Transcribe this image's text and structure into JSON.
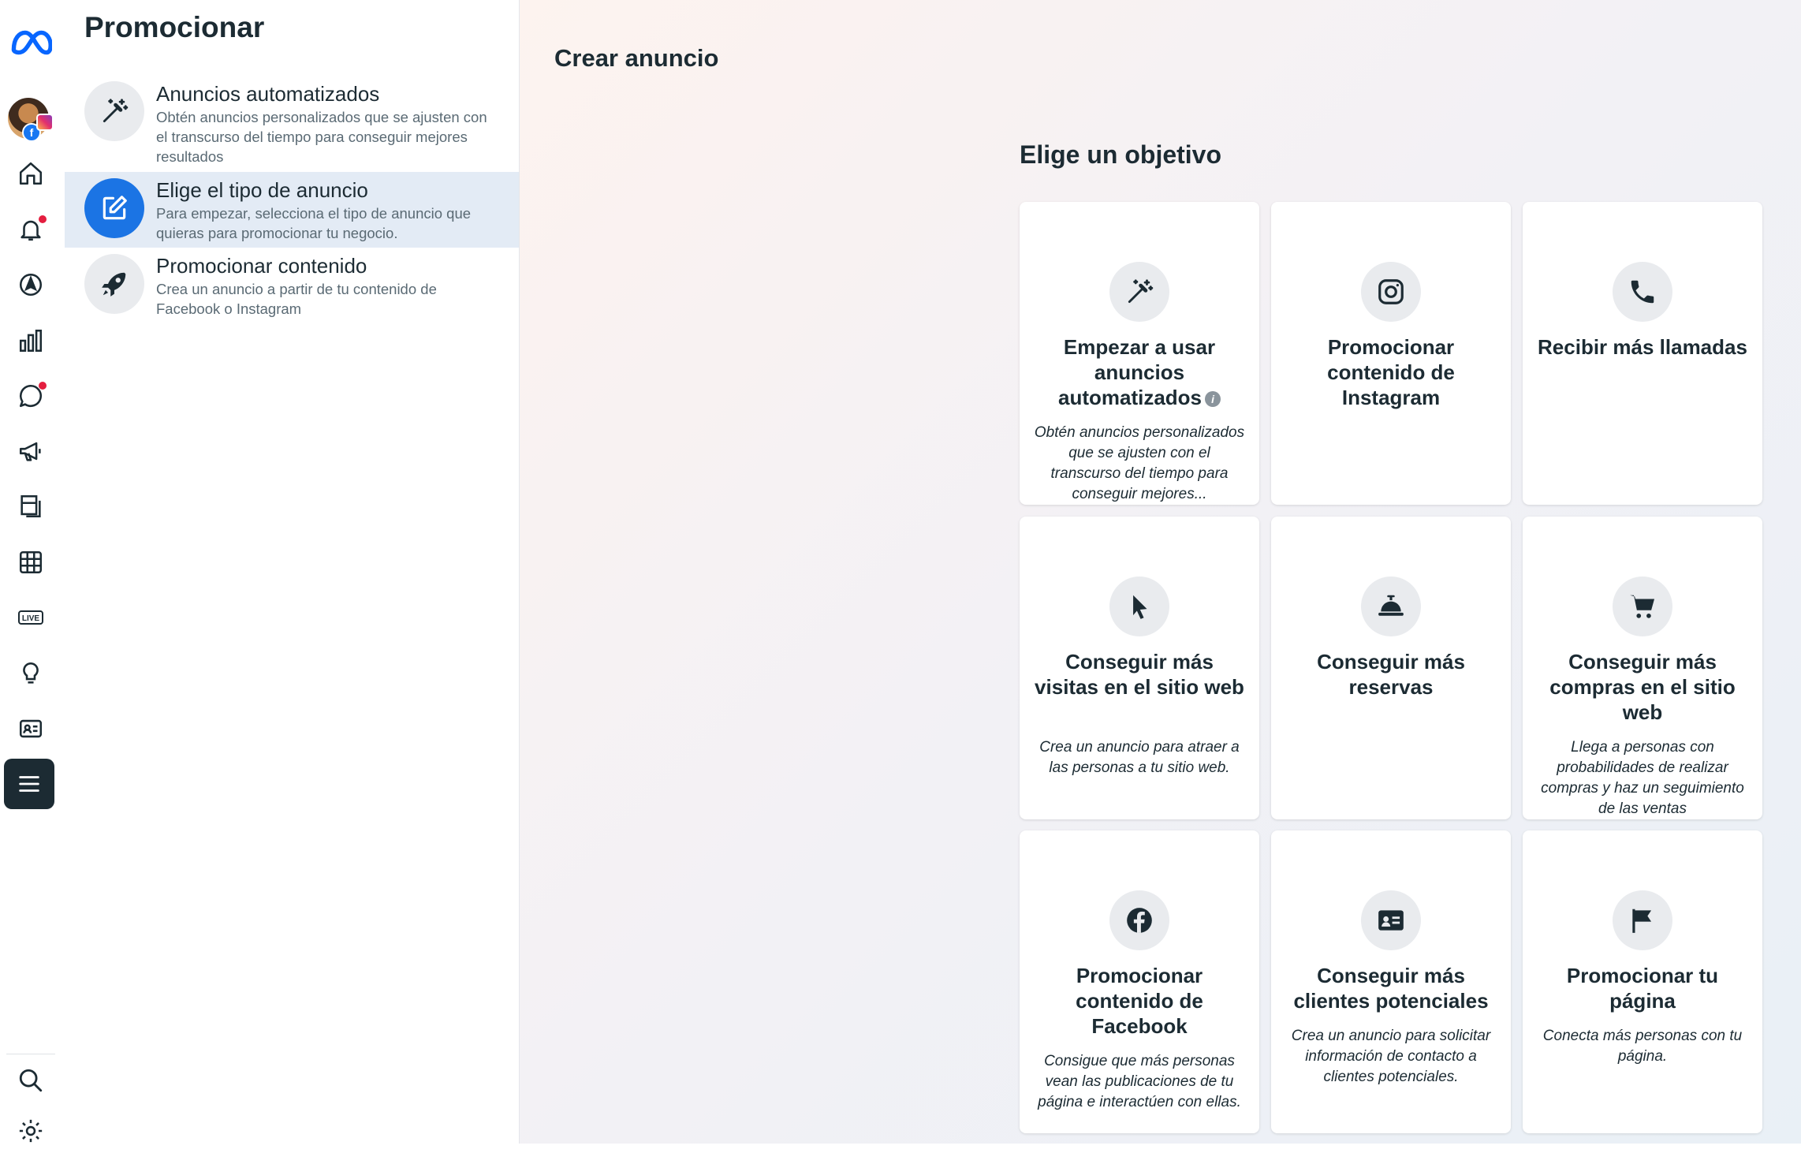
{
  "rail": {
    "logo": "meta-logo",
    "items": [
      "avatar",
      "home-icon",
      "bell-icon",
      "compass-icon",
      "bar-chart-icon",
      "chat-icon",
      "megaphone-icon",
      "pages-icon",
      "table-icon",
      "live-icon",
      "lightbulb-icon",
      "id-card-icon",
      "menu-icon",
      "search-icon",
      "gear-icon"
    ],
    "live_label": "LIVE"
  },
  "sidebar": {
    "title": "Promocionar",
    "items": [
      {
        "title": "Anuncios automatizados",
        "desc": "Obtén anuncios personalizados que se ajusten con el transcurso del tiempo para conseguir mejores resultados",
        "icon": "magic-wand-icon"
      },
      {
        "title": "Elige el tipo de anuncio",
        "desc": "Para empezar, selecciona el tipo de anuncio que quieras para promocionar tu negocio.",
        "icon": "edit-icon"
      },
      {
        "title": "Promocionar contenido",
        "desc": "Crea un anuncio a partir de tu contenido de Facebook o Instagram",
        "icon": "rocket-icon"
      }
    ]
  },
  "main": {
    "page_title": "Crear anuncio",
    "section_title": "Elige un objetivo",
    "cards": [
      {
        "title": "Empezar a usar anuncios automatizados",
        "desc": "Obtén anuncios personalizados que se ajusten con el transcurso del tiempo para conseguir mejores...",
        "icon": "magic-wand-icon"
      },
      {
        "title": "Promocionar contenido de Instagram",
        "desc": "",
        "icon": "instagram-icon"
      },
      {
        "title": "Recibir más llamadas",
        "desc": "",
        "icon": "phone-icon"
      },
      {
        "title": "Conseguir más visitas en el sitio web",
        "desc": "Crea un anuncio para atraer a las personas a tu sitio web.",
        "icon": "cursor-icon"
      },
      {
        "title": "Conseguir más reservas",
        "desc": "",
        "icon": "service-bell-icon"
      },
      {
        "title": "Conseguir más compras en el sitio web",
        "desc": "Llega a personas con probabilidades de realizar compras y haz un seguimiento de las ventas",
        "icon": "cart-icon"
      },
      {
        "title": "Promocionar contenido de Facebook",
        "desc": "Consigue que más personas vean las publicaciones de tu página e interactúen con ellas.",
        "icon": "facebook-icon"
      },
      {
        "title": "Conseguir más clientes potenciales",
        "desc": "Crea un anuncio para solicitar información de contacto a clientes potenciales.",
        "icon": "contact-card-icon"
      },
      {
        "title": "Promocionar tu página",
        "desc": "Conecta más personas con tu página.",
        "icon": "flag-icon"
      }
    ]
  },
  "colors": {
    "accent": "#1b74e4",
    "active_bg": "#e3ebf5",
    "text": "#1c2b33",
    "notification": "#e41e3f"
  }
}
